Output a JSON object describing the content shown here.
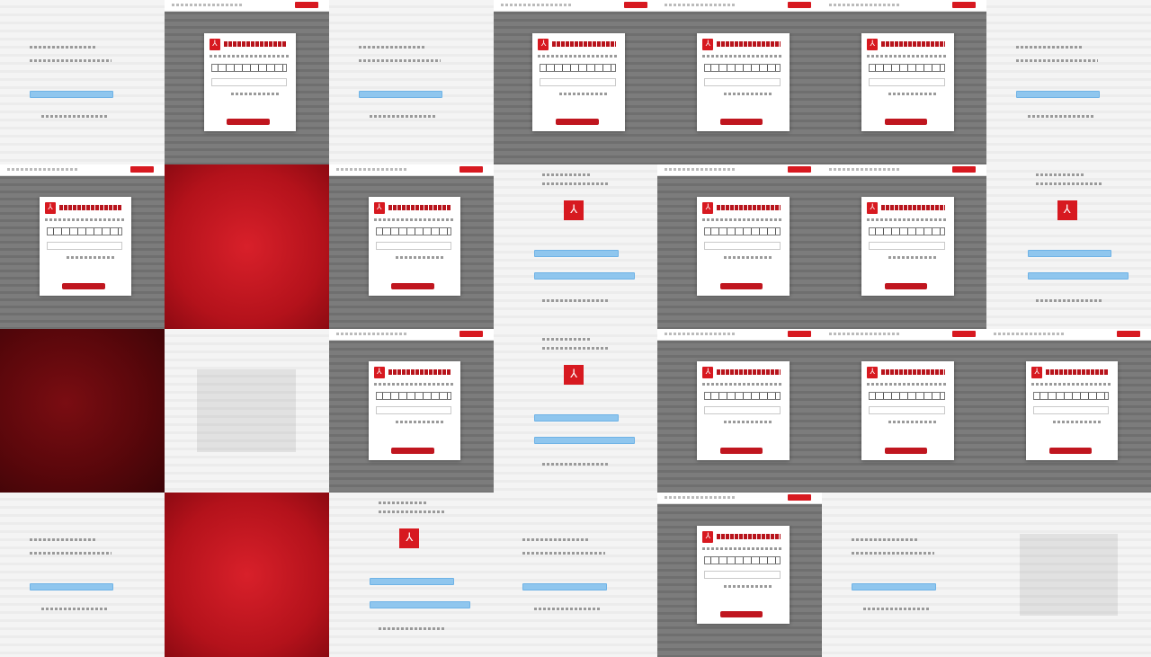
{
  "grid": {
    "rows": 4,
    "columns": 7,
    "tiles": [
      {
        "variant": "white-form",
        "background": "light"
      },
      {
        "variant": "card-form",
        "background": "gray"
      },
      {
        "variant": "white-form",
        "background": "light"
      },
      {
        "variant": "card-form",
        "background": "gray"
      },
      {
        "variant": "card-form",
        "background": "gray"
      },
      {
        "variant": "card-form",
        "background": "gray"
      },
      {
        "variant": "white-form",
        "background": "light"
      },
      {
        "variant": "card-form",
        "background": "gray"
      },
      {
        "variant": "solid",
        "background": "red"
      },
      {
        "variant": "card-form",
        "background": "gray"
      },
      {
        "variant": "pdf-landing",
        "background": "white"
      },
      {
        "variant": "card-form",
        "background": "gray"
      },
      {
        "variant": "card-form",
        "background": "gray"
      },
      {
        "variant": "pdf-landing",
        "background": "white"
      },
      {
        "variant": "solid",
        "background": "dark-red"
      },
      {
        "variant": "blur",
        "background": "light"
      },
      {
        "variant": "card-form",
        "background": "gray"
      },
      {
        "variant": "pdf-landing",
        "background": "white"
      },
      {
        "variant": "card-form",
        "background": "gray"
      },
      {
        "variant": "card-form",
        "background": "gray"
      },
      {
        "variant": "card-form",
        "background": "gray"
      },
      {
        "variant": "white-form",
        "background": "light"
      },
      {
        "variant": "solid",
        "background": "red"
      },
      {
        "variant": "pdf-landing",
        "background": "white"
      },
      {
        "variant": "white-form",
        "background": "light"
      },
      {
        "variant": "card-form",
        "background": "gray"
      },
      {
        "variant": "white-form",
        "background": "light"
      },
      {
        "variant": "blur",
        "background": "light"
      }
    ]
  },
  "colors": {
    "brand_red": "#d71920",
    "button_blue": "#8fc6ee",
    "card_white": "#ffffff",
    "backdrop_gray": "#777777"
  },
  "icons": {
    "logo": "pdf-logo-icon"
  }
}
